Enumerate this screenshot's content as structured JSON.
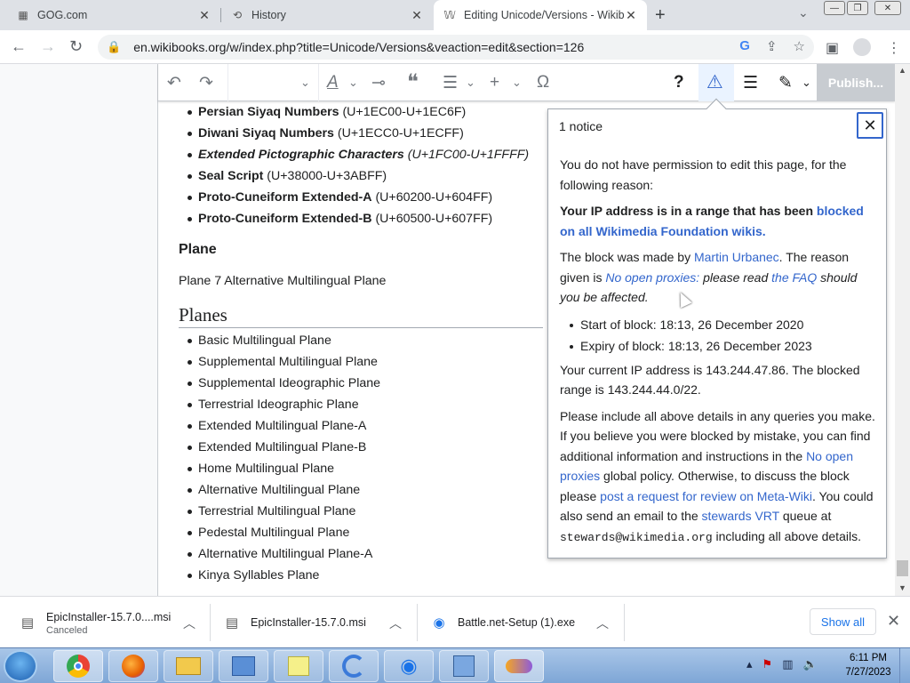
{
  "browser": {
    "tabs": [
      {
        "title": "GOG.com",
        "icon": "gog-icon"
      },
      {
        "title": "History",
        "icon": "history-icon"
      },
      {
        "title": "Editing Unicode/Versions - Wikib",
        "icon": "wikibooks-icon"
      }
    ],
    "url": "en.wikibooks.org/w/index.php?title=Unicode/Versions&veaction=edit&section=126"
  },
  "editor": {
    "publish_label": "Publish...",
    "toolbar_icons": [
      "undo-icon",
      "redo-icon",
      "text-style-icon",
      "link-icon",
      "quote-icon",
      "list-icon",
      "insert-icon",
      "special-character-icon",
      "help-icon",
      "notice-icon",
      "menu-icon",
      "edit-mode-icon"
    ]
  },
  "content": {
    "blocks": [
      {
        "name": "Persian Siyaq Numbers",
        "range": "(U+1EC00-U+1EC6F)",
        "style": "bold"
      },
      {
        "name": "Diwani Siyaq Numbers",
        "range": "(U+1ECC0-U+1ECFF)",
        "style": "bold"
      },
      {
        "name": "Extended Pictographic Characters",
        "range": "(U+1FC00-U+1FFFF)",
        "style": "bold-italic"
      },
      {
        "name": "Seal Script",
        "range": "(U+38000-U+3ABFF)",
        "style": "bold"
      },
      {
        "name": "Proto-Cuneiform Extended-A",
        "range": "(U+60200-U+604FF)",
        "style": "bold"
      },
      {
        "name": "Proto-Cuneiform Extended-B",
        "range": "(U+60500-U+607FF)",
        "style": "bold"
      }
    ],
    "plane_heading": "Plane",
    "plane_text": "Plane 7 Alternative Multilingual Plane",
    "planes_heading": "Planes",
    "planes": [
      "Basic Multilingual Plane",
      "Supplemental Multilingual Plane",
      "Supplemental Ideographic Plane",
      "Terrestrial Ideographic Plane",
      "Extended Multilingual Plane-A",
      "Extended Multilingual Plane-B",
      "Home Multilingual Plane",
      "Alternative Multilingual Plane",
      "Terrestrial Multilingual Plane",
      "Pedestal Multilingual Plane",
      "Alternative Multilingual Plane-A",
      "Kinya Syllables Plane"
    ]
  },
  "notice": {
    "title": "1 notice",
    "intro": "You do not have permission to edit this page, for the following reason:",
    "bold_text": "Your IP address is in a range that has been",
    "bold_link": "blocked on all Wikimedia Foundation wikis.",
    "made_by_prefix": "The block was made by",
    "made_by_link": "Martin Urbanec",
    "reason_prefix": ". The reason given is",
    "reason_link": "No open proxies:",
    "reason_italic": "please read",
    "faq_link": "the FAQ",
    "reason_suffix": "should you be affected.",
    "start": "Start of block: 18:13, 26 December 2020",
    "expiry": "Expiry of block: 18:13, 26 December 2023",
    "ip_text": "Your current IP address is 143.244.47.86. The blocked range is 143.244.44.0/22.",
    "include_text": "Please include all above details in any queries you make. If you believe you were blocked by mistake, you can find additional information and instructions in the",
    "proxies_link": "No open proxies",
    "policy_text": "global policy. Otherwise, to discuss the block please",
    "review_link": "post a request for review on Meta-Wiki",
    "email_text": ". You could also send an email to the",
    "vrt_link": "stewards VRT",
    "queue_text": "queue at",
    "email": "stewards@wikimedia.org",
    "end_text": "including all above details."
  },
  "downloads": {
    "items": [
      {
        "name": "EpicInstaller-15.7.0....msi",
        "status": "Canceled"
      },
      {
        "name": "EpicInstaller-15.7.0.msi",
        "status": ""
      },
      {
        "name": "Battle.net-Setup (1).exe",
        "status": ""
      }
    ],
    "show_all": "Show all"
  },
  "taskbar": {
    "time": "6:11 PM",
    "date": "7/27/2023"
  }
}
